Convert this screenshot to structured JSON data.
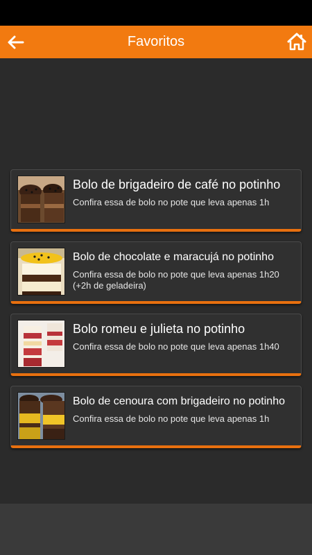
{
  "app_bar": {
    "title": "Favoritos",
    "back_icon": "arrow-left-icon",
    "home_icon": "home-icon",
    "color": "#f27a10"
  },
  "favorites": [
    {
      "title": "Bolo de brigadeiro de café no potinho",
      "description": "Confira essa de bolo no pote que leva apenas 1h"
    },
    {
      "title": "Bolo de chocolate e maracujá no potinho",
      "description": "Confira essa de bolo no pote que leva apenas 1h20 (+2h de geladeira)"
    },
    {
      "title": "Bolo romeu e julieta no potinho",
      "description": "Confira essa de bolo no pote que leva apenas 1h40"
    },
    {
      "title": "Bolo de cenoura com brigadeiro no potinho",
      "description": "Confira essa de bolo no pote que leva apenas 1h"
    }
  ]
}
